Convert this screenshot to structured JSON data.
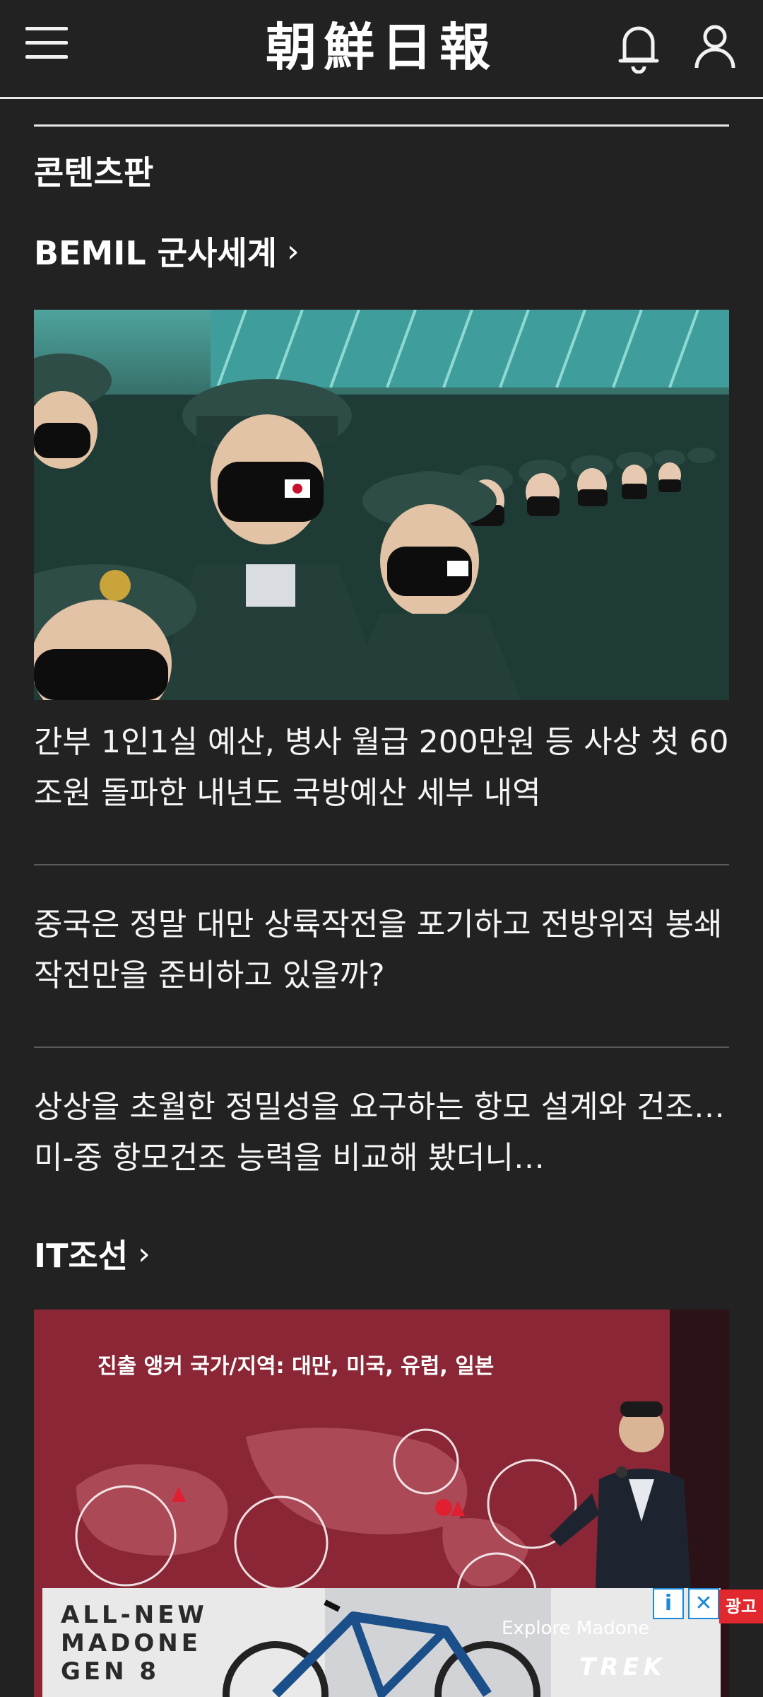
{
  "header": {
    "logo": "朝鮮日報",
    "menu_icon": "hamburger-menu-icon",
    "bell_icon": "bell-icon",
    "user_icon": "user-icon"
  },
  "section": {
    "title": "콘텐츠판"
  },
  "categories": [
    {
      "label": "BEMIL 군사세계",
      "chevron": "›",
      "articles": [
        "간부 1인1실 예산, 병사 월급 200만원 등 사상 첫 60조원 돌파한 내년도 국방예산 세부 내역",
        "중국은 정말 대만 상륙작전을 포기하고 전방위적 봉쇄작전만을 준비하고 있을까?",
        "상상을 초월한 정밀성을 요구하는 항모 설계와 건조… 미-중 항모건조 능력을 비교해 봤더니…"
      ]
    },
    {
      "label": "IT조선",
      "chevron": "›",
      "slide_title": "진출 앵커 국가/지역: 대만, 미국, 유럽, 일본"
    }
  ],
  "ad": {
    "headline": "ALL-NEW\nMADONE\nGEN 8",
    "cta": "Explore Madone",
    "brand": "TREK",
    "info_badge": "i",
    "close_badge": "✕",
    "tag": "광고"
  },
  "colors": {
    "background": "#222222",
    "text": "#f2f2f2",
    "divider": "#5a5a5a",
    "ad_tag": "#e0282e",
    "ad_badge": "#1a8ad8"
  }
}
